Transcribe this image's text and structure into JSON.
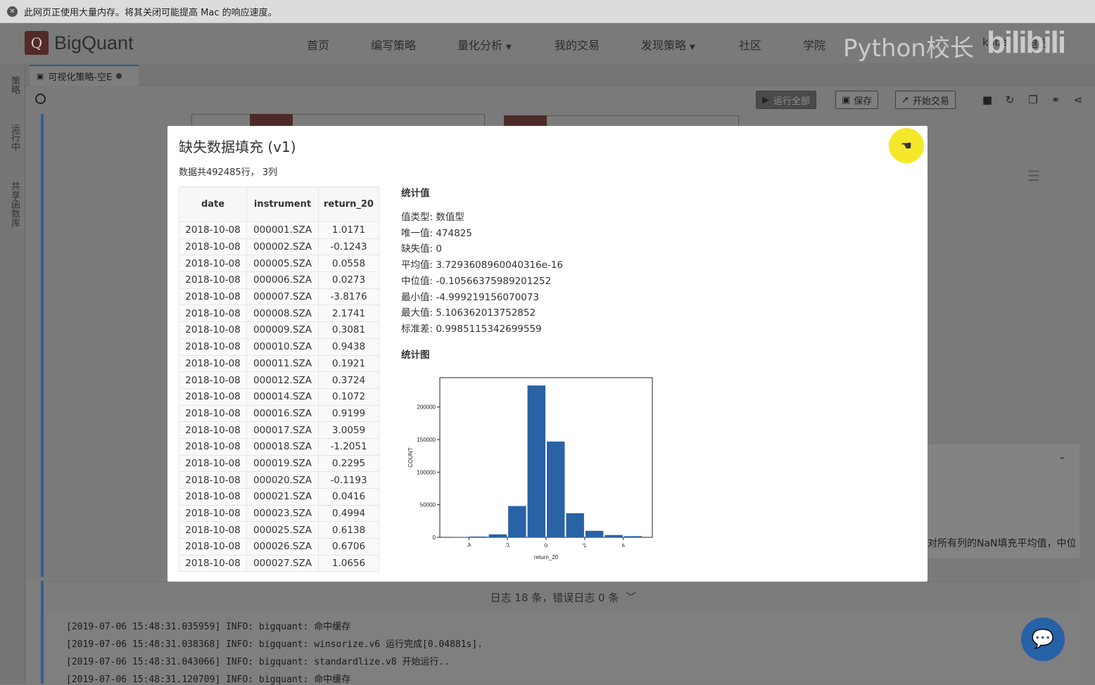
{
  "browser_warning": "此网页正使用大量内存。将其关闭可能提高 Mac 的响应速度。",
  "app": {
    "logo_letter": "Q",
    "logo_text": "BigQuant",
    "nav": [
      "首页",
      "编写策略",
      "量化分析",
      "我的交易",
      "发现策略",
      "社区",
      "学院"
    ],
    "user": "kobe",
    "logout": "退出",
    "watermark": "Python校长",
    "watermark_logo": "bilibili"
  },
  "rail_tabs": [
    "策略",
    "运行中",
    "共享函数库"
  ],
  "doc_tab": {
    "title": "可视化策略-空E"
  },
  "toolbar": {
    "run_all": "运行全部",
    "save": "保存",
    "start_trade": "开始交易"
  },
  "side_panel_text": "对所有列的NaN填充平均值，中位",
  "log": {
    "header": "日志 18 条，错误日志 0 条",
    "lines": [
      "[2019-07-06 15:48:31.035959] INFO: bigquant: 命中缓存",
      "[2019-07-06 15:48:31.038368] INFO: bigquant: winsorize.v6 运行完成[0.04881s].",
      "[2019-07-06 15:48:31.043066] INFO: bigquant: standardlize.v8 开始运行..",
      "[2019-07-06 15:48:31.120709] INFO: bigquant: 命中缓存"
    ]
  },
  "modal": {
    "title": "缺失数据填充 (v1)",
    "summary": "数据共492485行， 3列",
    "table": {
      "columns": [
        "date",
        "instrument",
        "return_20"
      ],
      "rows": [
        [
          "2018-10-08",
          "000001.SZA",
          "1.0171"
        ],
        [
          "2018-10-08",
          "000002.SZA",
          "-0.1243"
        ],
        [
          "2018-10-08",
          "000005.SZA",
          "0.0558"
        ],
        [
          "2018-10-08",
          "000006.SZA",
          "0.0273"
        ],
        [
          "2018-10-08",
          "000007.SZA",
          "-3.8176"
        ],
        [
          "2018-10-08",
          "000008.SZA",
          "2.1741"
        ],
        [
          "2018-10-08",
          "000009.SZA",
          "0.3081"
        ],
        [
          "2018-10-08",
          "000010.SZA",
          "0.9438"
        ],
        [
          "2018-10-08",
          "000011.SZA",
          "0.1921"
        ],
        [
          "2018-10-08",
          "000012.SZA",
          "0.3724"
        ],
        [
          "2018-10-08",
          "000014.SZA",
          "0.1072"
        ],
        [
          "2018-10-08",
          "000016.SZA",
          "0.9199"
        ],
        [
          "2018-10-08",
          "000017.SZA",
          "3.0059"
        ],
        [
          "2018-10-08",
          "000018.SZA",
          "-1.2051"
        ],
        [
          "2018-10-08",
          "000019.SZA",
          "0.2295"
        ],
        [
          "2018-10-08",
          "000020.SZA",
          "-0.1193"
        ],
        [
          "2018-10-08",
          "000021.SZA",
          "0.0416"
        ],
        [
          "2018-10-08",
          "000023.SZA",
          "0.4994"
        ],
        [
          "2018-10-08",
          "000025.SZA",
          "0.6138"
        ],
        [
          "2018-10-08",
          "000026.SZA",
          "0.6706"
        ],
        [
          "2018-10-08",
          "000027.SZA",
          "1.0656"
        ]
      ]
    },
    "stats": {
      "heading": "统计值",
      "items": [
        "值类型: 数值型",
        "唯一值: 474825",
        "缺失值:  0",
        "平均值:  3.7293608960040316e-16",
        "中位值:  -0.10566375989201252",
        "最小值:  -4.999219156070073",
        "最大值:  5.106362013752852",
        "标准差:  0.9985115342699559"
      ],
      "chart_heading": "统计图"
    }
  },
  "chart_data": {
    "type": "bar",
    "title": "",
    "xlabel": "return_20",
    "ylabel": "COUNT",
    "bar_color": "#2a62a6",
    "x_ticks": [
      -4,
      -2,
      0,
      2,
      4
    ],
    "y_ticks": [
      0,
      50000,
      100000,
      150000,
      200000
    ],
    "xlim": [
      -5.5,
      5.5
    ],
    "ylim": [
      0,
      245000
    ],
    "bins": [
      {
        "x0": -5.0,
        "x1": -4.0,
        "value": 300
      },
      {
        "x0": -4.0,
        "x1": -3.0,
        "value": 1200
      },
      {
        "x0": -3.0,
        "x1": -2.0,
        "value": 4500
      },
      {
        "x0": -2.0,
        "x1": -1.0,
        "value": 48000
      },
      {
        "x0": -1.0,
        "x1": 0.0,
        "value": 233000
      },
      {
        "x0": 0.0,
        "x1": 1.0,
        "value": 147000
      },
      {
        "x0": 1.0,
        "x1": 2.0,
        "value": 37000
      },
      {
        "x0": 2.0,
        "x1": 3.0,
        "value": 10000
      },
      {
        "x0": 3.0,
        "x1": 4.0,
        "value": 3500
      },
      {
        "x0": 4.0,
        "x1": 5.0,
        "value": 1800
      }
    ]
  }
}
